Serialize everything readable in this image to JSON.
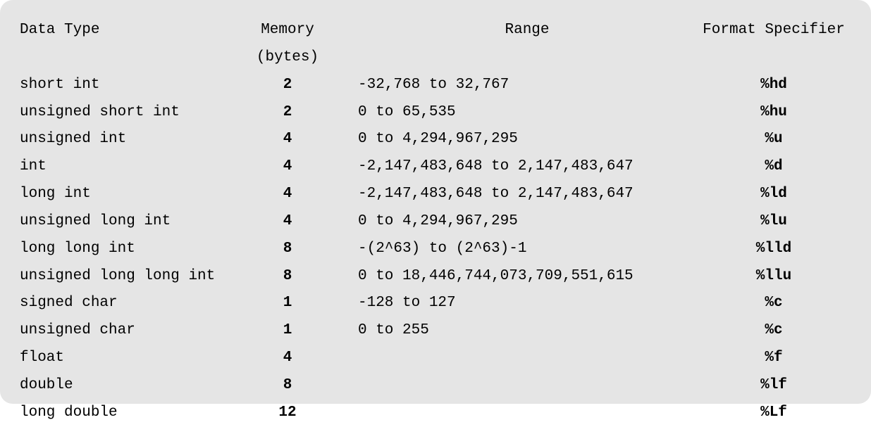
{
  "headers": {
    "type": "Data Type",
    "memory": "Memory (bytes)",
    "range": "Range",
    "format": "Format Specifier"
  },
  "rows": [
    {
      "type": "short int",
      "memory": "2",
      "range": "-32,768 to 32,767",
      "format": "%hd"
    },
    {
      "type": "unsigned short int",
      "memory": "2",
      "range": "0 to 65,535",
      "format": "%hu"
    },
    {
      "type": "unsigned int",
      "memory": "4",
      "range": "0 to 4,294,967,295",
      "format": "%u"
    },
    {
      "type": "int",
      "memory": "4",
      "range": "-2,147,483,648 to 2,147,483,647",
      "format": "%d"
    },
    {
      "type": "long int",
      "memory": "4",
      "range": "-2,147,483,648 to 2,147,483,647",
      "format": "%ld"
    },
    {
      "type": "unsigned long int",
      "memory": "4",
      "range": "0 to 4,294,967,295",
      "format": "%lu"
    },
    {
      "type": "long long int",
      "memory": "8",
      "range": "-(2^63) to (2^63)-1",
      "format": "%lld"
    },
    {
      "type": "unsigned long long int",
      "memory": "8",
      "range": "0 to 18,446,744,073,709,551,615",
      "format": "%llu"
    },
    {
      "type": "signed char",
      "memory": "1",
      "range": "-128 to 127",
      "format": "%c"
    },
    {
      "type": "unsigned char",
      "memory": "1",
      "range": "0 to 255",
      "format": "%c"
    },
    {
      "type": "float",
      "memory": "4",
      "range": "",
      "format": "%f"
    },
    {
      "type": "double",
      "memory": "8",
      "range": "",
      "format": "%lf"
    },
    {
      "type": "long double",
      "memory": "12",
      "range": "",
      "format": "%Lf"
    }
  ]
}
